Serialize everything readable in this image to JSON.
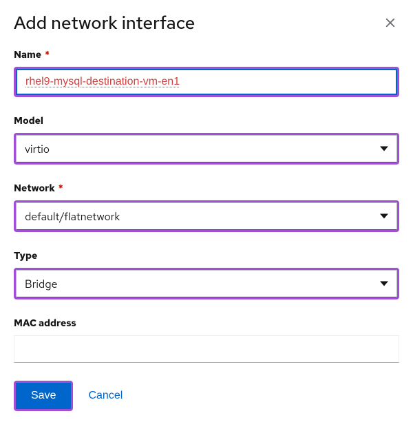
{
  "modal": {
    "title": "Add network interface"
  },
  "fields": {
    "name": {
      "label": "Name",
      "required": true,
      "value": "rhel9-mysql-destination-vm-en1"
    },
    "model": {
      "label": "Model",
      "required": false,
      "value": "virtio"
    },
    "network": {
      "label": "Network",
      "required": true,
      "value": "default/flatnetwork"
    },
    "type": {
      "label": "Type",
      "required": false,
      "value": "Bridge"
    },
    "mac": {
      "label": "MAC address",
      "required": false,
      "value": ""
    }
  },
  "actions": {
    "save": "Save",
    "cancel": "Cancel"
  },
  "required_marker": "*"
}
